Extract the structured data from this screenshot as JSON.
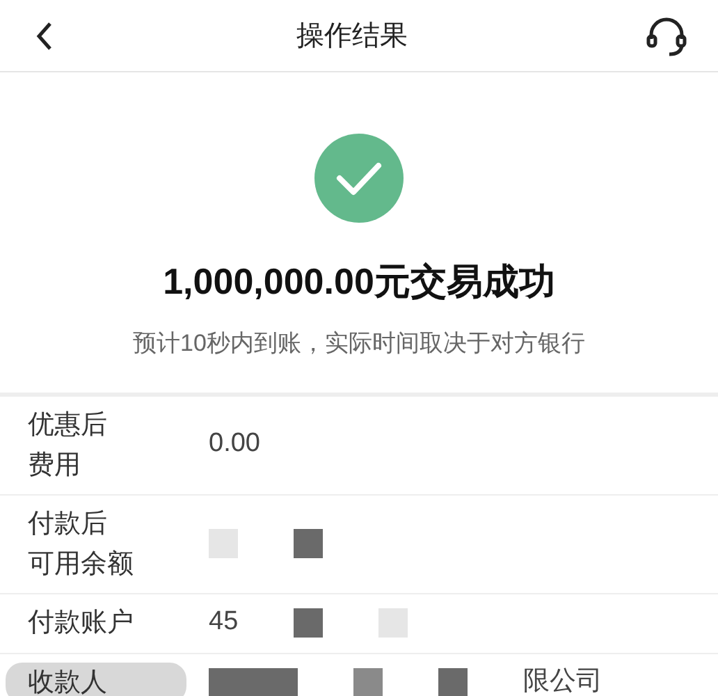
{
  "header": {
    "title": "操作结果"
  },
  "result": {
    "title": "1,000,000.00元交易成功",
    "subtitle": "预计10秒内到账，实际时间取决于对方银行"
  },
  "rows": [
    {
      "label": [
        "优惠后",
        "费用"
      ],
      "value": [
        {
          "kind": "text",
          "text": "0.00"
        }
      ]
    },
    {
      "label": [
        "付款后",
        "可用余额"
      ],
      "value": [
        {
          "kind": "redaction",
          "color": "#e6e6e6"
        },
        {
          "kind": "redaction",
          "color": "#6a6a6a"
        }
      ]
    },
    {
      "label": [
        "付款账户"
      ],
      "value": [
        {
          "kind": "text",
          "text": "45"
        },
        {
          "kind": "redaction",
          "color": "#6a6a6a"
        },
        {
          "kind": "redaction",
          "color": "#e6e6e6"
        }
      ]
    },
    {
      "label": [
        "收款人"
      ],
      "value": [
        {
          "kind": "redaction-bar",
          "color": "#6a6a6a"
        },
        {
          "kind": "redaction",
          "color": "#8a8a8a"
        },
        {
          "kind": "redaction",
          "color": "#6a6a6a"
        },
        {
          "kind": "text",
          "text": "限公司"
        }
      ]
    }
  ]
}
